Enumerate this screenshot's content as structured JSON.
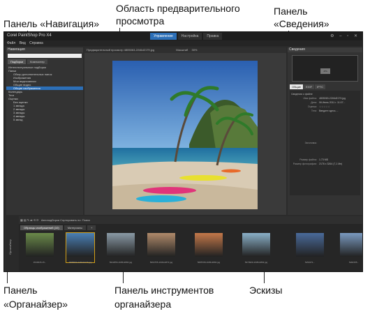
{
  "callouts": {
    "nav_panel_l1": "Панель «Навигация»",
    "preview_area_l1": "Область предварительного",
    "preview_area_l2": "просмотра",
    "info_panel_l1": "Панель",
    "info_panel_l2": "«Сведения»",
    "organizer_panel_l1": "Панель",
    "organizer_panel_l2": "«Органайзер»",
    "organizer_toolbar_l1": "Панель инструментов",
    "organizer_toolbar_l2": "органайзера",
    "thumbnails_l1": "Эскизы"
  },
  "app": {
    "title": "Corel PaintShop Pro X4",
    "tabs": [
      "Управление",
      "Настройка",
      "Правка"
    ],
    "active_tab": "Управление",
    "menu": [
      "Файл",
      "Вид",
      "Справка"
    ],
    "accent": "#2c6fb7"
  },
  "navigation": {
    "header": "Навигация",
    "tabs": [
      "Подборки",
      "Компьютер"
    ],
    "tree": [
      "Интеллектуальные подборки",
      "Папки",
      "Обзор дополнительных папок",
      "Изображения",
      "Мои видеозаписи",
      "Общие видео",
      "Общие изображения",
      "Календарь",
      "Теги",
      "Оценки",
      "Без оценки",
      "1 звезда",
      "2 звезды",
      "3 звезды",
      "4 звезды",
      "5 звезд"
    ],
    "selected_index": 6
  },
  "preview": {
    "toolbar_text": "Предварительный просмотр   4805063-2246d2179.jpg",
    "zoom": "30%",
    "fit_label": "Масштаб"
  },
  "info": {
    "header": "Сведения",
    "histogram_label": "JPG",
    "tabs": [
      "Общие",
      "EXIF",
      "IPTC"
    ],
    "active_tab": "Общие",
    "section": "Сведения о файле",
    "rows": [
      {
        "k": "Имя файла:",
        "v": "4805063-2246d2179.jpg"
      },
      {
        "k": "Дата:",
        "v": "06 Июнь 2011 г.  11:07..."
      },
      {
        "k": "Оценка:",
        "v": "☆☆☆☆☆"
      },
      {
        "k": "Теги:",
        "v": "Введите здесь ..."
      },
      {
        "k": "Заголовок:",
        "v": ""
      },
      {
        "k": "Размер файла:",
        "v": "1.73 МБ"
      },
      {
        "k": "Размер фотографии:",
        "v": "2176 x 3264 (7,1 Мп)"
      }
    ]
  },
  "organizer": {
    "tools_text": "Автоподборка   Сортировать по:   Поиск",
    "tabs": [
      "Образцы изображений (10)",
      "Материалы"
    ],
    "add_tab": "+",
    "side_label": "Органайзер",
    "thumbs": [
      {
        "cap": "4543915-15...",
        "color": "#6a8a4a"
      },
      {
        "cap": "4805063-2246d2179.jpg",
        "color": "#4a7fb5"
      },
      {
        "cap": "5022656-1935x2893.jpg",
        "color": "#8a9aa6"
      },
      {
        "cap": "5094755-1933x2872.jpg",
        "color": "#b08a6a"
      },
      {
        "cap": "5085708-1935x2893.jpg",
        "color": "#c4784a"
      },
      {
        "cap": "5070909-1935x2893.jpg",
        "color": "#8ab0c8"
      },
      {
        "cap": "5253271...",
        "color": "#4a6a9a"
      },
      {
        "cap": "5282155...",
        "color": "#7a9ac0"
      }
    ]
  }
}
